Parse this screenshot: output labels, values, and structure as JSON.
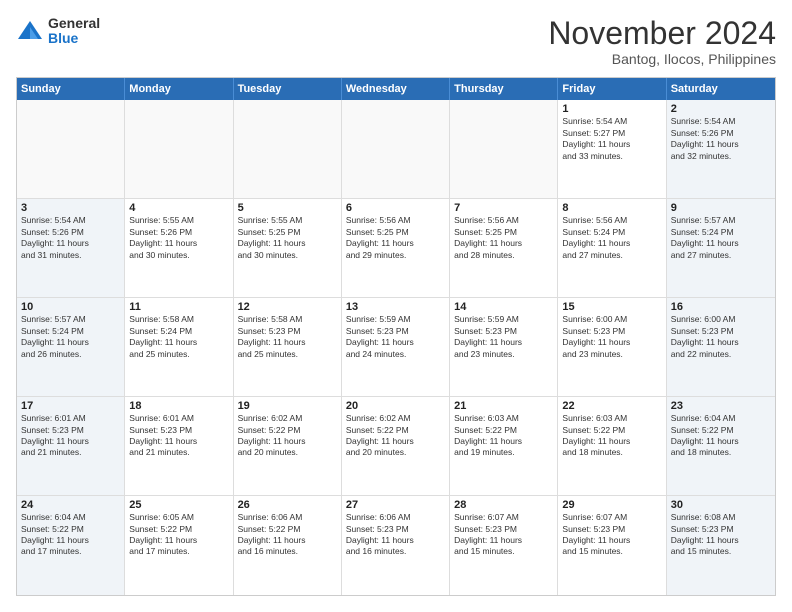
{
  "logo": {
    "general": "General",
    "blue": "Blue"
  },
  "title": "November 2024",
  "location": "Bantog, Ilocos, Philippines",
  "weekdays": [
    "Sunday",
    "Monday",
    "Tuesday",
    "Wednesday",
    "Thursday",
    "Friday",
    "Saturday"
  ],
  "weeks": [
    [
      {
        "day": "",
        "info": "",
        "empty": true
      },
      {
        "day": "",
        "info": "",
        "empty": true
      },
      {
        "day": "",
        "info": "",
        "empty": true
      },
      {
        "day": "",
        "info": "",
        "empty": true
      },
      {
        "day": "",
        "info": "",
        "empty": true
      },
      {
        "day": "1",
        "info": "Sunrise: 5:54 AM\nSunset: 5:27 PM\nDaylight: 11 hours\nand 33 minutes."
      },
      {
        "day": "2",
        "info": "Sunrise: 5:54 AM\nSunset: 5:26 PM\nDaylight: 11 hours\nand 32 minutes.",
        "shaded": true
      }
    ],
    [
      {
        "day": "3",
        "info": "Sunrise: 5:54 AM\nSunset: 5:26 PM\nDaylight: 11 hours\nand 31 minutes.",
        "shaded": true
      },
      {
        "day": "4",
        "info": "Sunrise: 5:55 AM\nSunset: 5:26 PM\nDaylight: 11 hours\nand 30 minutes."
      },
      {
        "day": "5",
        "info": "Sunrise: 5:55 AM\nSunset: 5:25 PM\nDaylight: 11 hours\nand 30 minutes."
      },
      {
        "day": "6",
        "info": "Sunrise: 5:56 AM\nSunset: 5:25 PM\nDaylight: 11 hours\nand 29 minutes."
      },
      {
        "day": "7",
        "info": "Sunrise: 5:56 AM\nSunset: 5:25 PM\nDaylight: 11 hours\nand 28 minutes."
      },
      {
        "day": "8",
        "info": "Sunrise: 5:56 AM\nSunset: 5:24 PM\nDaylight: 11 hours\nand 27 minutes."
      },
      {
        "day": "9",
        "info": "Sunrise: 5:57 AM\nSunset: 5:24 PM\nDaylight: 11 hours\nand 27 minutes.",
        "shaded": true
      }
    ],
    [
      {
        "day": "10",
        "info": "Sunrise: 5:57 AM\nSunset: 5:24 PM\nDaylight: 11 hours\nand 26 minutes.",
        "shaded": true
      },
      {
        "day": "11",
        "info": "Sunrise: 5:58 AM\nSunset: 5:24 PM\nDaylight: 11 hours\nand 25 minutes."
      },
      {
        "day": "12",
        "info": "Sunrise: 5:58 AM\nSunset: 5:23 PM\nDaylight: 11 hours\nand 25 minutes."
      },
      {
        "day": "13",
        "info": "Sunrise: 5:59 AM\nSunset: 5:23 PM\nDaylight: 11 hours\nand 24 minutes."
      },
      {
        "day": "14",
        "info": "Sunrise: 5:59 AM\nSunset: 5:23 PM\nDaylight: 11 hours\nand 23 minutes."
      },
      {
        "day": "15",
        "info": "Sunrise: 6:00 AM\nSunset: 5:23 PM\nDaylight: 11 hours\nand 23 minutes."
      },
      {
        "day": "16",
        "info": "Sunrise: 6:00 AM\nSunset: 5:23 PM\nDaylight: 11 hours\nand 22 minutes.",
        "shaded": true
      }
    ],
    [
      {
        "day": "17",
        "info": "Sunrise: 6:01 AM\nSunset: 5:23 PM\nDaylight: 11 hours\nand 21 minutes.",
        "shaded": true
      },
      {
        "day": "18",
        "info": "Sunrise: 6:01 AM\nSunset: 5:23 PM\nDaylight: 11 hours\nand 21 minutes."
      },
      {
        "day": "19",
        "info": "Sunrise: 6:02 AM\nSunset: 5:22 PM\nDaylight: 11 hours\nand 20 minutes."
      },
      {
        "day": "20",
        "info": "Sunrise: 6:02 AM\nSunset: 5:22 PM\nDaylight: 11 hours\nand 20 minutes."
      },
      {
        "day": "21",
        "info": "Sunrise: 6:03 AM\nSunset: 5:22 PM\nDaylight: 11 hours\nand 19 minutes."
      },
      {
        "day": "22",
        "info": "Sunrise: 6:03 AM\nSunset: 5:22 PM\nDaylight: 11 hours\nand 18 minutes."
      },
      {
        "day": "23",
        "info": "Sunrise: 6:04 AM\nSunset: 5:22 PM\nDaylight: 11 hours\nand 18 minutes.",
        "shaded": true
      }
    ],
    [
      {
        "day": "24",
        "info": "Sunrise: 6:04 AM\nSunset: 5:22 PM\nDaylight: 11 hours\nand 17 minutes.",
        "shaded": true
      },
      {
        "day": "25",
        "info": "Sunrise: 6:05 AM\nSunset: 5:22 PM\nDaylight: 11 hours\nand 17 minutes."
      },
      {
        "day": "26",
        "info": "Sunrise: 6:06 AM\nSunset: 5:22 PM\nDaylight: 11 hours\nand 16 minutes."
      },
      {
        "day": "27",
        "info": "Sunrise: 6:06 AM\nSunset: 5:23 PM\nDaylight: 11 hours\nand 16 minutes."
      },
      {
        "day": "28",
        "info": "Sunrise: 6:07 AM\nSunset: 5:23 PM\nDaylight: 11 hours\nand 15 minutes."
      },
      {
        "day": "29",
        "info": "Sunrise: 6:07 AM\nSunset: 5:23 PM\nDaylight: 11 hours\nand 15 minutes."
      },
      {
        "day": "30",
        "info": "Sunrise: 6:08 AM\nSunset: 5:23 PM\nDaylight: 11 hours\nand 15 minutes.",
        "shaded": true
      }
    ]
  ]
}
